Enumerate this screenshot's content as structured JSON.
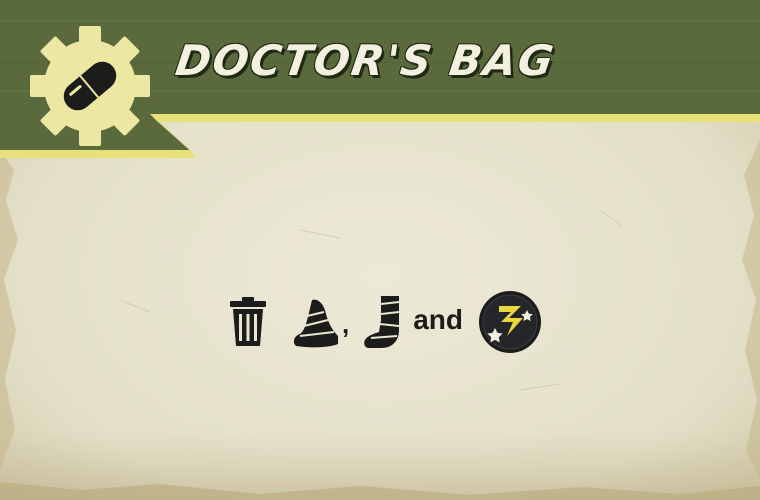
{
  "card": {
    "title": "DOCTOR'S BAG",
    "header_icon": "pill-capsule-icon",
    "colors": {
      "header_green": "#5b6a3c",
      "stripe_yellow": "#e8e07a",
      "gear_cream": "#ece8a4",
      "parchment": "#e9e6d2",
      "ink": "#1c1c1a",
      "bolt_yellow": "#e9d73c"
    }
  },
  "effect": {
    "icons": [
      "trash-can-icon",
      "bandaged-arm-icon",
      "bandaged-leg-icon",
      "stunned-token-icon"
    ],
    "separator": ",",
    "joiner": "and"
  }
}
